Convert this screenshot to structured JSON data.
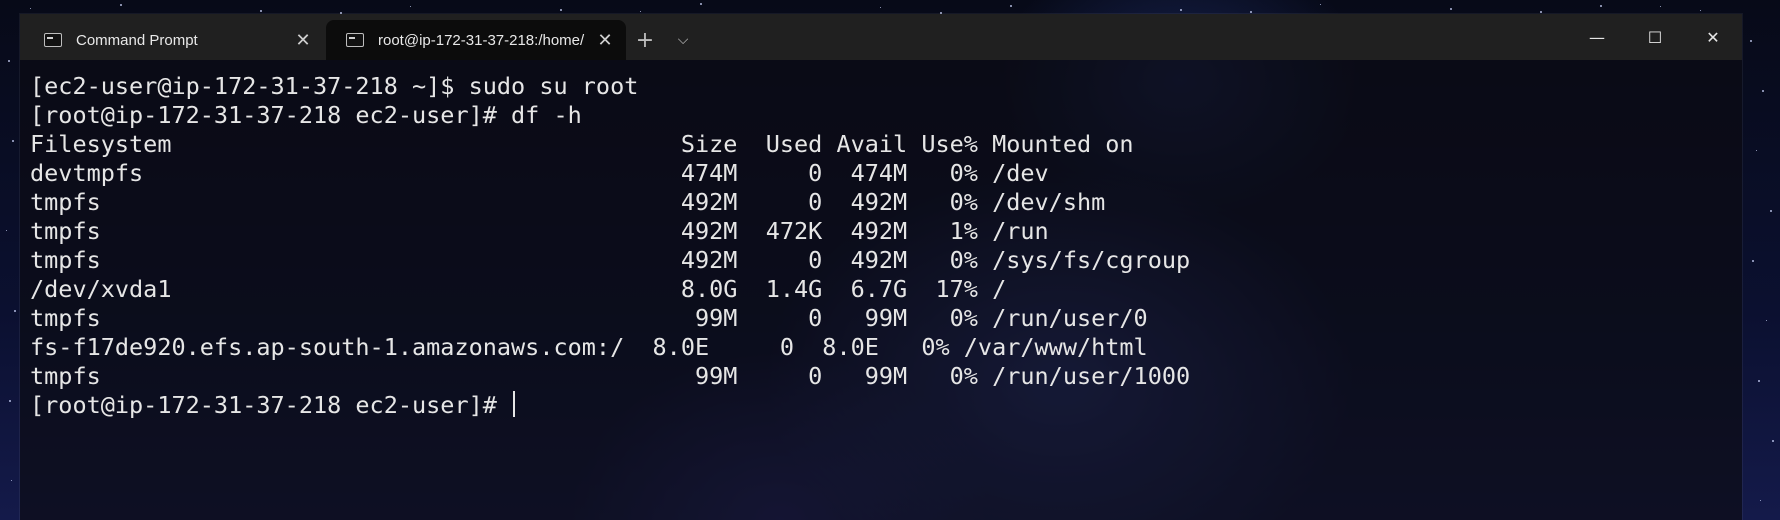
{
  "tabs": [
    {
      "label": "Command Prompt",
      "icon": "terminal-icon",
      "active": false
    },
    {
      "label": "root@ip-172-31-37-218:/home/",
      "icon": "terminal-icon",
      "active": true
    }
  ],
  "tab_close_glyph": "✕",
  "new_tab_glyph": "+",
  "dropdown_glyph": "⌵",
  "window_controls": {
    "minimize": "—",
    "maximize": "☐",
    "close": "✕"
  },
  "terminal": {
    "lines": [
      "[ec2-user@ip-172-31-37-218 ~]$ sudo su root",
      "[root@ip-172-31-37-218 ec2-user]# df -h",
      "Filesystem                                    Size  Used Avail Use% Mounted on",
      "devtmpfs                                      474M     0  474M   0% /dev",
      "tmpfs                                         492M     0  492M   0% /dev/shm",
      "tmpfs                                         492M  472K  492M   1% /run",
      "tmpfs                                         492M     0  492M   0% /sys/fs/cgroup",
      "/dev/xvda1                                    8.0G  1.4G  6.7G  17% /",
      "tmpfs                                          99M     0   99M   0% /run/user/0",
      "fs-f17de920.efs.ap-south-1.amazonaws.com:/  8.0E     0  8.0E   0% /var/www/html",
      "tmpfs                                          99M     0   99M   0% /run/user/1000"
    ],
    "prompt": "[root@ip-172-31-37-218 ec2-user]# "
  }
}
